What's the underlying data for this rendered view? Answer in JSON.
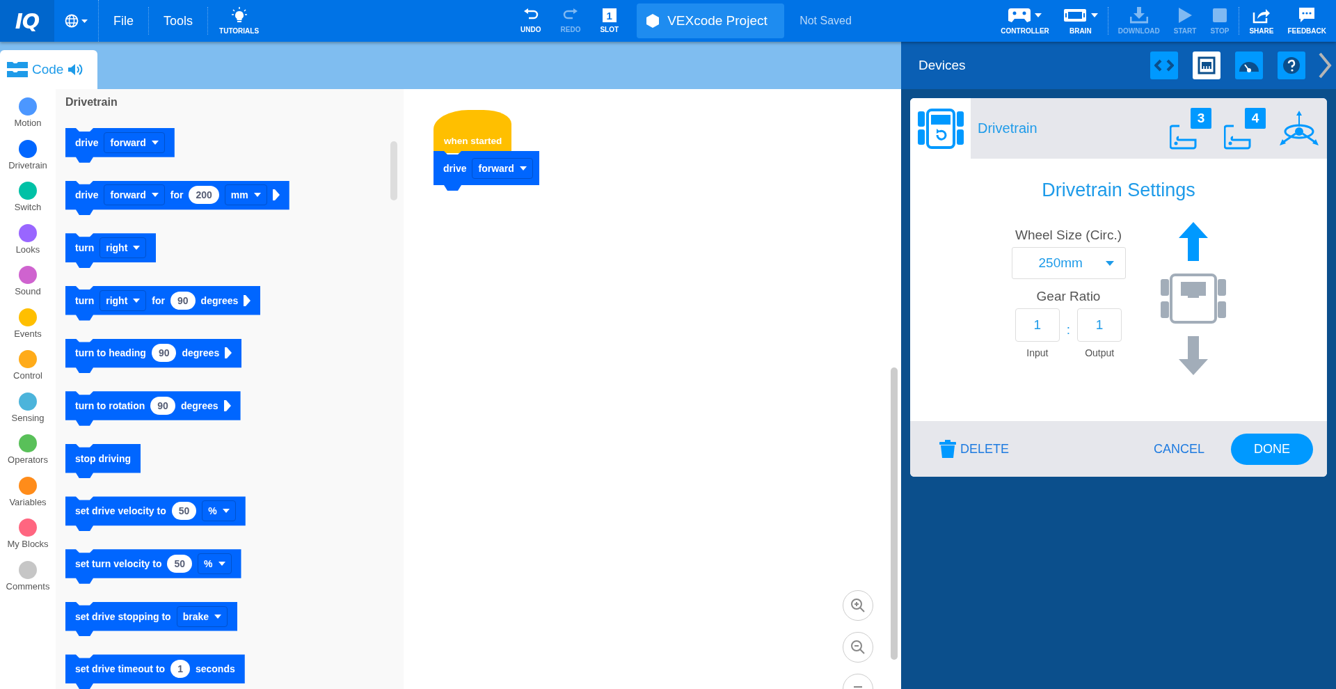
{
  "toolbar": {
    "logo": "IQ",
    "menus": [
      "File",
      "Tools"
    ],
    "tutorials": "TUTORIALS",
    "center_buttons": [
      {
        "kind": "undo",
        "label": "UNDO",
        "disabled": false
      },
      {
        "kind": "redo",
        "label": "REDO",
        "disabled": true
      },
      {
        "kind": "slot",
        "label": "SLOT",
        "number": "1",
        "disabled": false
      }
    ],
    "project_name": "VEXcode Project",
    "save_status": "Not Saved",
    "right_buttons": [
      {
        "kind": "controller",
        "label": "CONTROLLER",
        "disabled": false
      },
      {
        "kind": "brain",
        "label": "BRAIN",
        "disabled": false
      },
      {
        "kind": "download",
        "label": "DOWNLOAD",
        "disabled": true
      },
      {
        "kind": "start",
        "label": "START",
        "disabled": true
      },
      {
        "kind": "stop",
        "label": "STOP",
        "disabled": true
      },
      {
        "kind": "share",
        "label": "SHARE",
        "disabled": false
      },
      {
        "kind": "feedback",
        "label": "FEEDBACK",
        "disabled": false
      }
    ]
  },
  "editor_tab": {
    "label": "Code"
  },
  "categories": [
    {
      "name": "Motion",
      "color": "#4c97ff"
    },
    {
      "name": "Drivetrain",
      "color": "#0066ff"
    },
    {
      "name": "Switch",
      "color": "#00c1a6"
    },
    {
      "name": "Looks",
      "color": "#9966ff"
    },
    {
      "name": "Sound",
      "color": "#cf63cf"
    },
    {
      "name": "Events",
      "color": "#ffbf00"
    },
    {
      "name": "Control",
      "color": "#ffab19"
    },
    {
      "name": "Sensing",
      "color": "#4cb4db"
    },
    {
      "name": "Operators",
      "color": "#59c059"
    },
    {
      "name": "Variables",
      "color": "#ff8c1a"
    },
    {
      "name": "My Blocks",
      "color": "#ff6680"
    },
    {
      "name": "Comments",
      "color": "#c6c6c6"
    }
  ],
  "palette": {
    "title": "Drivetrain",
    "blocks": [
      {
        "parts": [
          {
            "kind": "text",
            "text": "drive"
          },
          {
            "kind": "dropdown",
            "text": "forward"
          }
        ]
      },
      {
        "parts": [
          {
            "kind": "text",
            "text": "drive"
          },
          {
            "kind": "dropdown",
            "text": "forward"
          },
          {
            "kind": "text",
            "text": "for"
          },
          {
            "kind": "number",
            "text": "200"
          },
          {
            "kind": "dropdown",
            "text": "mm"
          },
          {
            "kind": "arrow"
          }
        ]
      },
      {
        "parts": [
          {
            "kind": "text",
            "text": "turn"
          },
          {
            "kind": "dropdown",
            "text": "right"
          }
        ]
      },
      {
        "parts": [
          {
            "kind": "text",
            "text": "turn"
          },
          {
            "kind": "dropdown",
            "text": "right"
          },
          {
            "kind": "text",
            "text": "for"
          },
          {
            "kind": "number",
            "text": "90"
          },
          {
            "kind": "text",
            "text": "degrees"
          },
          {
            "kind": "arrow"
          }
        ]
      },
      {
        "parts": [
          {
            "kind": "text",
            "text": "turn to heading"
          },
          {
            "kind": "number",
            "text": "90"
          },
          {
            "kind": "text",
            "text": "degrees"
          },
          {
            "kind": "arrow"
          }
        ]
      },
      {
        "parts": [
          {
            "kind": "text",
            "text": "turn to rotation"
          },
          {
            "kind": "number",
            "text": "90"
          },
          {
            "kind": "text",
            "text": "degrees"
          },
          {
            "kind": "arrow"
          }
        ]
      },
      {
        "parts": [
          {
            "kind": "text",
            "text": "stop driving"
          }
        ]
      },
      {
        "parts": [
          {
            "kind": "text",
            "text": "set drive velocity to"
          },
          {
            "kind": "number",
            "text": "50"
          },
          {
            "kind": "dropdown",
            "text": "%"
          }
        ]
      },
      {
        "parts": [
          {
            "kind": "text",
            "text": "set turn velocity to"
          },
          {
            "kind": "number",
            "text": "50"
          },
          {
            "kind": "dropdown",
            "text": "%"
          }
        ]
      },
      {
        "parts": [
          {
            "kind": "text",
            "text": "set drive stopping to"
          },
          {
            "kind": "dropdown",
            "text": "brake"
          }
        ]
      },
      {
        "parts": [
          {
            "kind": "text",
            "text": "set drive timeout to"
          },
          {
            "kind": "number",
            "text": "1"
          },
          {
            "kind": "text",
            "text": "seconds"
          }
        ]
      }
    ]
  },
  "canvas": {
    "hat_block": "when started",
    "stack_block": {
      "parts": [
        {
          "kind": "text",
          "text": "drive"
        },
        {
          "kind": "dropdown",
          "text": "forward"
        }
      ]
    }
  },
  "devices": {
    "title": "Devices",
    "tabs": [
      {
        "kind": "code",
        "selected": false
      },
      {
        "kind": "devices",
        "selected": true
      },
      {
        "kind": "dashboard",
        "selected": false
      },
      {
        "kind": "help",
        "selected": false
      }
    ],
    "device": {
      "name": "Drivetrain",
      "ports": [
        "3",
        "4"
      ],
      "settings_title": "Drivetrain Settings",
      "wheel_size": {
        "label": "Wheel Size (Circ.)",
        "value": "250mm"
      },
      "gear_ratio": {
        "label": "Gear Ratio",
        "input": "1",
        "separator": ":",
        "output": "1",
        "input_label": "Input",
        "output_label": "Output"
      },
      "delete": "DELETE",
      "cancel": "CANCEL",
      "done": "DONE"
    }
  }
}
